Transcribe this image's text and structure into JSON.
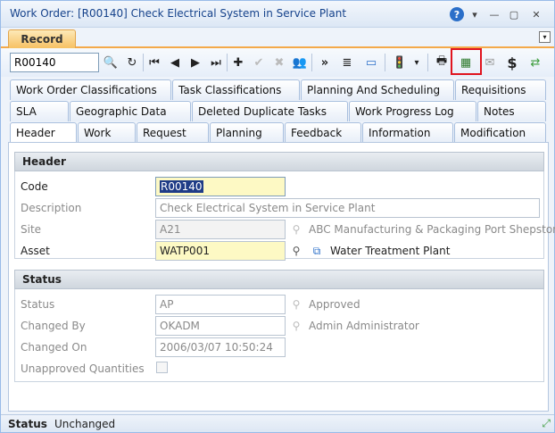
{
  "window": {
    "title": "Work Order: [R00140] Check Electrical System in Service Plant",
    "help_icon": "?",
    "dropdown_icon": "▾",
    "minimize_icon": "—",
    "maximize_icon": "▢",
    "close_icon": "✕"
  },
  "record_tab": {
    "label": "Record",
    "collapse_icon": "▾"
  },
  "toolbar": {
    "code_value": "R00140",
    "icons": {
      "search": "🔍",
      "refresh": "↻",
      "first": "⏮",
      "prev": "◀",
      "next": "▶",
      "last": "⏭",
      "add": "✚",
      "confirm": "✔",
      "cancel": "✖",
      "people": "👥",
      "more": "»",
      "list": "≣",
      "window": "▭",
      "traffic_light": "🚦",
      "dropdown": "▾",
      "print": "🖶",
      "calendar": "▦",
      "mail": "✉",
      "dollar": "$",
      "export": "⇄"
    }
  },
  "tabs": {
    "row1": [
      "Work Order Classifications",
      "Task Classifications",
      "Planning And Scheduling",
      "Requisitions"
    ],
    "row2": [
      "SLA",
      "Geographic Data",
      "Deleted Duplicate Tasks",
      "Work Progress Log",
      "Notes"
    ],
    "row3": [
      "Header",
      "Work",
      "Request",
      "Planning",
      "Feedback",
      "Information",
      "Modification"
    ]
  },
  "header_group": {
    "title": "Header",
    "code_label": "Code",
    "code_value": "R00140",
    "description_label": "Description",
    "description_value": "Check Electrical System in Service Plant",
    "site_label": "Site",
    "site_value": "A21",
    "site_name": "ABC Manufacturing & Packaging Port Shepstor",
    "asset_label": "Asset",
    "asset_value": "WATP001",
    "asset_name": "Water Treatment Plant"
  },
  "status_group": {
    "title": "Status",
    "status_label": "Status",
    "status_value": "AP",
    "status_name": "Approved",
    "changed_by_label": "Changed By",
    "changed_by_value": "OKADM",
    "changed_by_name": "Admin Administrator",
    "changed_on_label": "Changed On",
    "changed_on_value": "2006/03/07 10:50:24",
    "unapproved_label": "Unapproved Quantities"
  },
  "statusbar": {
    "label": "Status",
    "value": "Unchanged",
    "resize_icon": "⤢"
  },
  "colors": {
    "accent": "#f4a94a",
    "highlight": "#e0141e",
    "required_bg": "#fdf9c4"
  }
}
